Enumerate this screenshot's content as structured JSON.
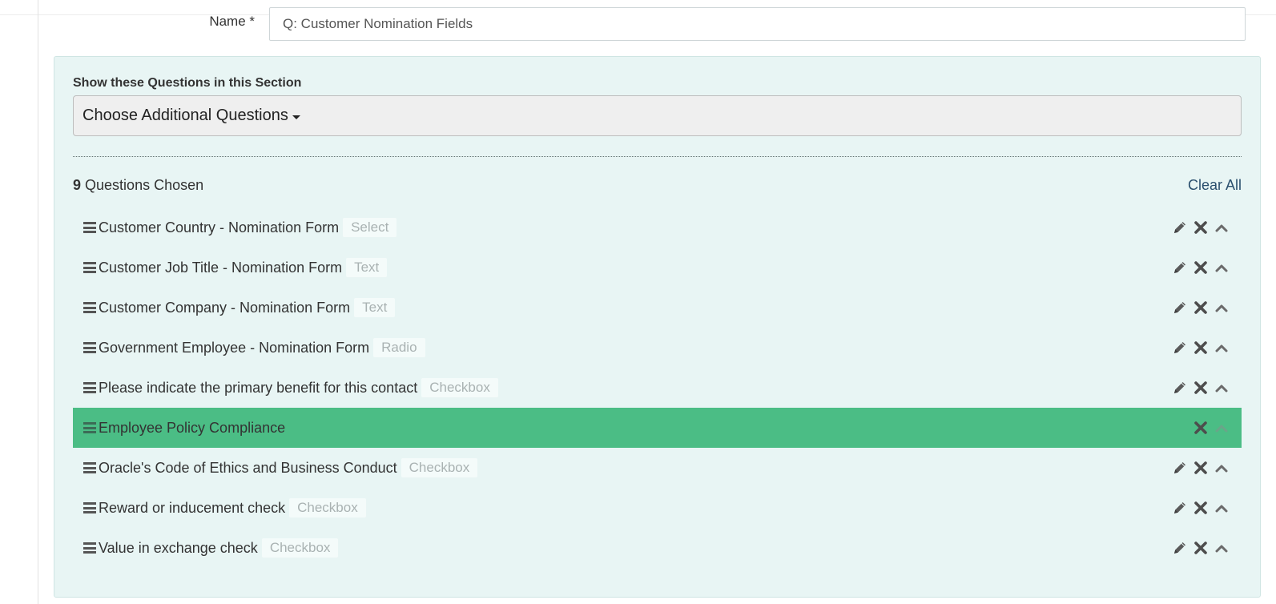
{
  "form": {
    "name_label": "Name *",
    "name_value": "Q: Customer Nomination Fields"
  },
  "section": {
    "show_label": "Show these Questions in this Section",
    "choose_label": "Choose Additional Questions",
    "chosen_count": "9",
    "chosen_label": "Questions Chosen",
    "clear_all": "Clear All"
  },
  "questions": [
    {
      "label": "Customer Country - Nomination Form",
      "type": "Select"
    },
    {
      "label": "Customer Job Title - Nomination Form",
      "type": "Text"
    },
    {
      "label": "Customer Company - Nomination Form",
      "type": "Text"
    },
    {
      "label": "Government Employee - Nomination Form",
      "type": "Radio"
    },
    {
      "label": "Please indicate the primary benefit for this contact",
      "type": "Checkbox"
    },
    {
      "label": "Employee Policy Compliance",
      "type": "",
      "highlighted": true
    },
    {
      "label": "Oracle's Code of Ethics and Business Conduct",
      "type": "Checkbox"
    },
    {
      "label": "Reward or inducement check",
      "type": "Checkbox"
    },
    {
      "label": "Value in exchange check",
      "type": "Checkbox"
    }
  ],
  "icons": [
    "drag-handle-icon",
    "pencil-icon",
    "close-icon",
    "chevron-up-icon",
    "caret-down-icon"
  ],
  "colors": {
    "panel_bg": "#e8f5f4",
    "highlight_row": "#4bbd85",
    "link": "#2a4f6e"
  }
}
